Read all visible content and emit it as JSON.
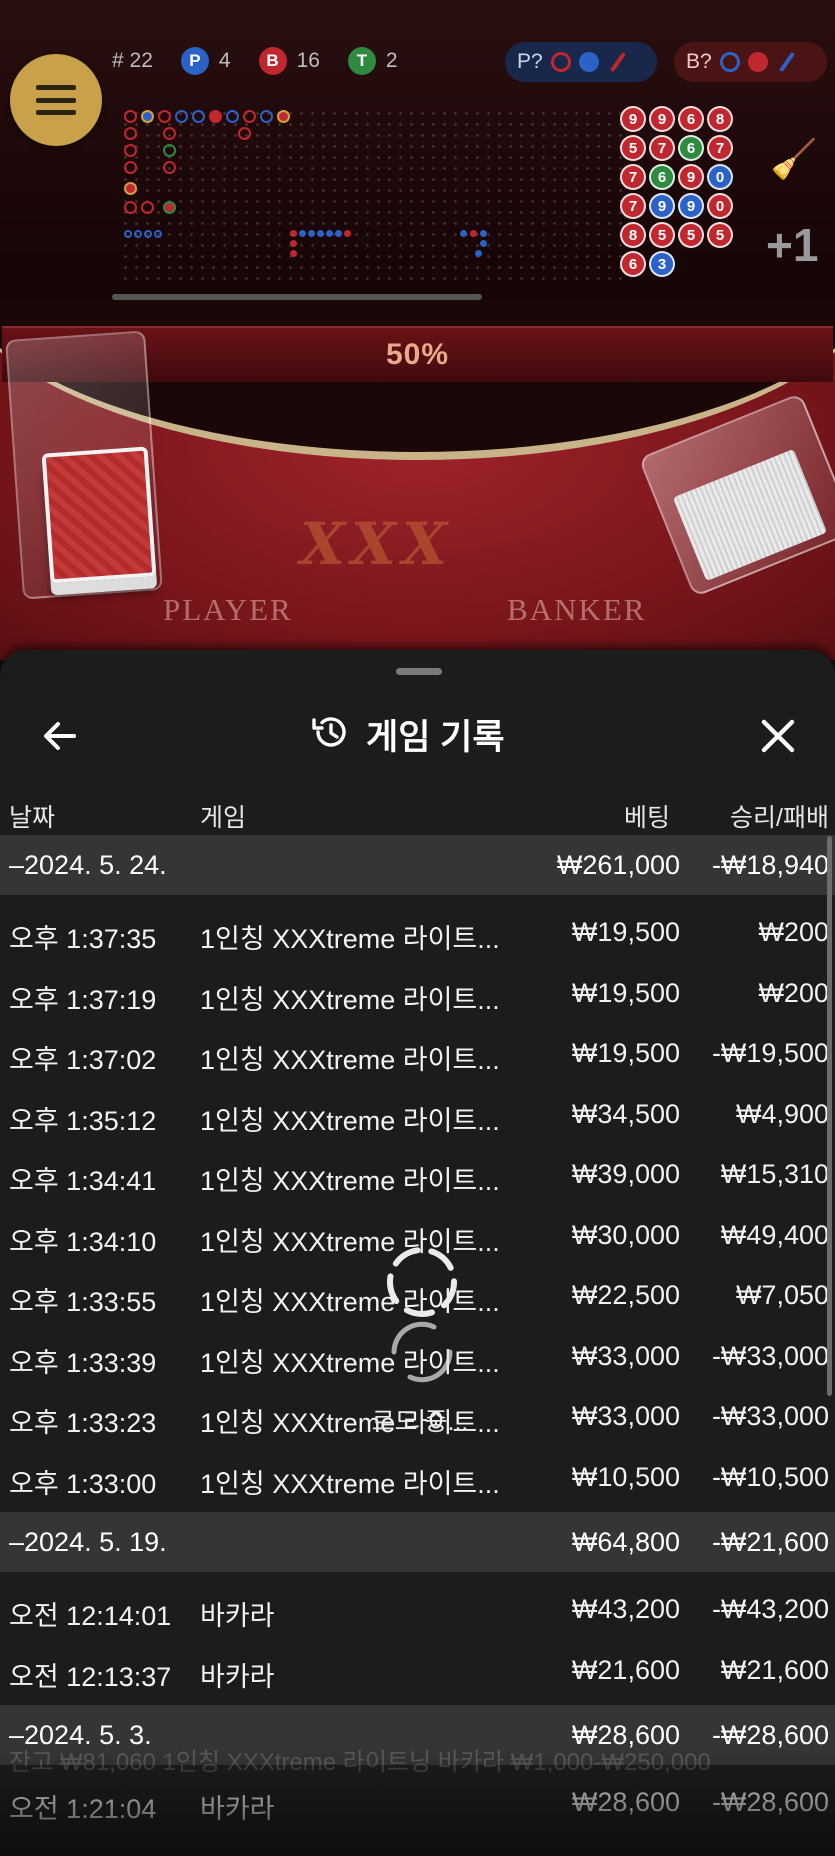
{
  "roadmap": {
    "round_count": "# 22",
    "player_badge": "P",
    "player_count": "4",
    "banker_badge": "B",
    "banker_count": "16",
    "tie_badge": "T",
    "tie_count": "2",
    "player_predict_label": "P?",
    "banker_predict_label": "B?",
    "bead_values": [
      "9",
      "9",
      "6",
      "8",
      "5",
      "7",
      "6",
      "7",
      "7",
      "6",
      "9",
      "0",
      "7",
      "9",
      "9",
      "0",
      "8",
      "5",
      "5",
      "5",
      "6",
      "3"
    ],
    "plus_label": "+1",
    "colors": {
      "player": "#2a62c7",
      "banker": "#c0272f",
      "tie": "#2d8a3f",
      "gold": "#c9a14a"
    }
  },
  "table": {
    "progress_percent": "50%",
    "logo_text": "XXX",
    "player_zone": "PLAYER",
    "banker_zone": "BANKER"
  },
  "sheet": {
    "title": "게임 기록",
    "columns": {
      "date": "날짜",
      "game": "게임",
      "bet": "베팅",
      "win_loss": "승리/패배"
    },
    "groups": [
      {
        "date": "–2024. 5. 24.",
        "bet_total": "₩261,000",
        "wl_total": "-₩18,940",
        "rows": [
          {
            "time": "오후 1:37:35",
            "game": "1인칭 XXXtreme 라이트...",
            "bet": "₩19,500",
            "wl": "₩200"
          },
          {
            "time": "오후 1:37:19",
            "game": "1인칭 XXXtreme 라이트...",
            "bet": "₩19,500",
            "wl": "₩200"
          },
          {
            "time": "오후 1:37:02",
            "game": "1인칭 XXXtreme 라이트...",
            "bet": "₩19,500",
            "wl": "-₩19,500"
          },
          {
            "time": "오후 1:35:12",
            "game": "1인칭 XXXtreme 라이트...",
            "bet": "₩34,500",
            "wl": "₩4,900"
          },
          {
            "time": "오후 1:34:41",
            "game": "1인칭 XXXtreme 라이트...",
            "bet": "₩39,000",
            "wl": "₩15,310"
          },
          {
            "time": "오후 1:34:10",
            "game": "1인칭 XXXtreme 라이트...",
            "bet": "₩30,000",
            "wl": "₩49,400"
          },
          {
            "time": "오후 1:33:55",
            "game": "1인칭 XXXtreme 라이트...",
            "bet": "₩22,500",
            "wl": "₩7,050"
          },
          {
            "time": "오후 1:33:39",
            "game": "1인칭 XXXtreme 라이트...",
            "bet": "₩33,000",
            "wl": "-₩33,000"
          },
          {
            "time": "오후 1:33:23",
            "game": "1인칭 XXXtreme 라이트...",
            "bet": "₩33,000",
            "wl": "-₩33,000"
          },
          {
            "time": "오후 1:33:00",
            "game": "1인칭 XXXtreme 라이트...",
            "bet": "₩10,500",
            "wl": "-₩10,500"
          }
        ]
      },
      {
        "date": "–2024. 5. 19.",
        "bet_total": "₩64,800",
        "wl_total": "-₩21,600",
        "rows": [
          {
            "time": "오전 12:14:01",
            "game": "바카라",
            "bet": "₩43,200",
            "wl": "-₩43,200"
          },
          {
            "time": "오전 12:13:37",
            "game": "바카라",
            "bet": "₩21,600",
            "wl": "₩21,600"
          }
        ]
      },
      {
        "date": "–2024. 5. 3.",
        "bet_total": "₩28,600",
        "wl_total": "-₩28,600",
        "rows": [
          {
            "time": "오전 1:21:04",
            "game": "바카라",
            "bet": "₩28,600",
            "wl": "-₩28,600"
          }
        ]
      }
    ],
    "ghost_text": "잔고 ₩81,060          1인칭 XXXtreme 라이트닝 바카라 ₩1,000-₩250,000",
    "loading_text": "로드 중..."
  }
}
